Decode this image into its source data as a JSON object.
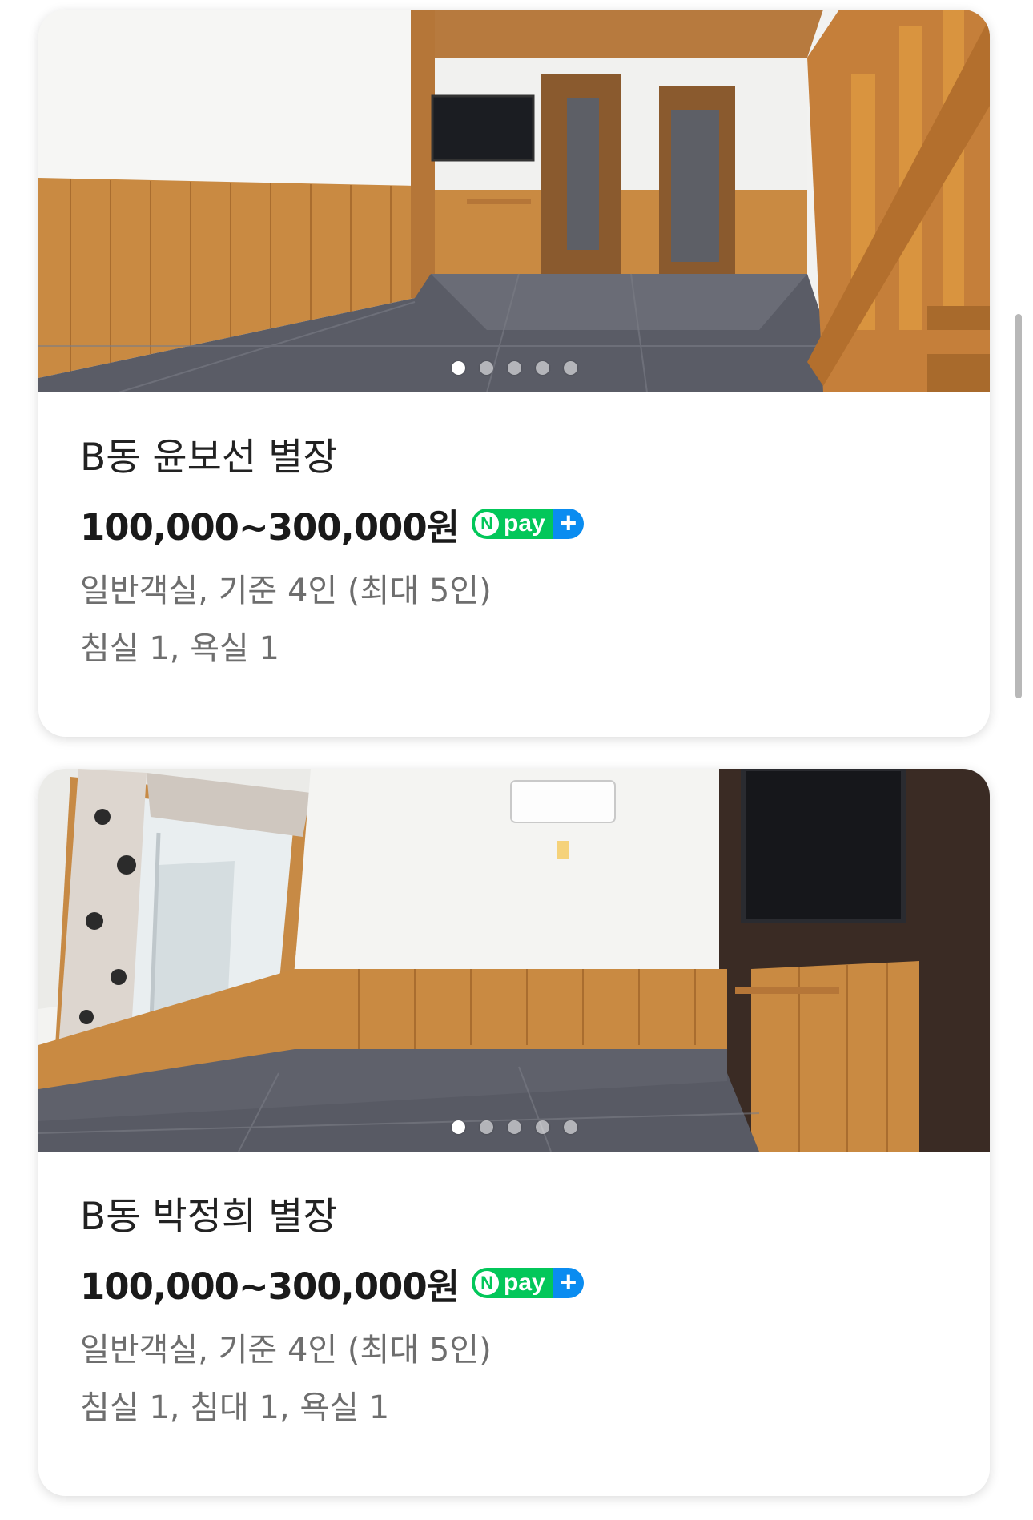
{
  "rooms": [
    {
      "title": "B동 윤보선 별장",
      "price": "100,000~300,000원",
      "npay": {
        "n": "N",
        "text": "pay",
        "plus": "+"
      },
      "type_capacity": "일반객실, 기준 4인 (최대 5인)",
      "facilities": "침실 1, 욕실 1",
      "photo_count": 5,
      "active_photo": 1
    },
    {
      "title": "B동 박정희 별장",
      "price": "100,000~300,000원",
      "npay": {
        "n": "N",
        "text": "pay",
        "plus": "+"
      },
      "type_capacity": "일반객실, 기준 4인 (최대 5인)",
      "facilities": "침실 1, 침대 1, 욕실 1",
      "photo_count": 5,
      "active_photo": 1
    }
  ],
  "colors": {
    "npay_green": "#03c75a",
    "npay_blue": "#0a8cf0",
    "wood": "#c8853d",
    "floor": "#5a5c66"
  }
}
